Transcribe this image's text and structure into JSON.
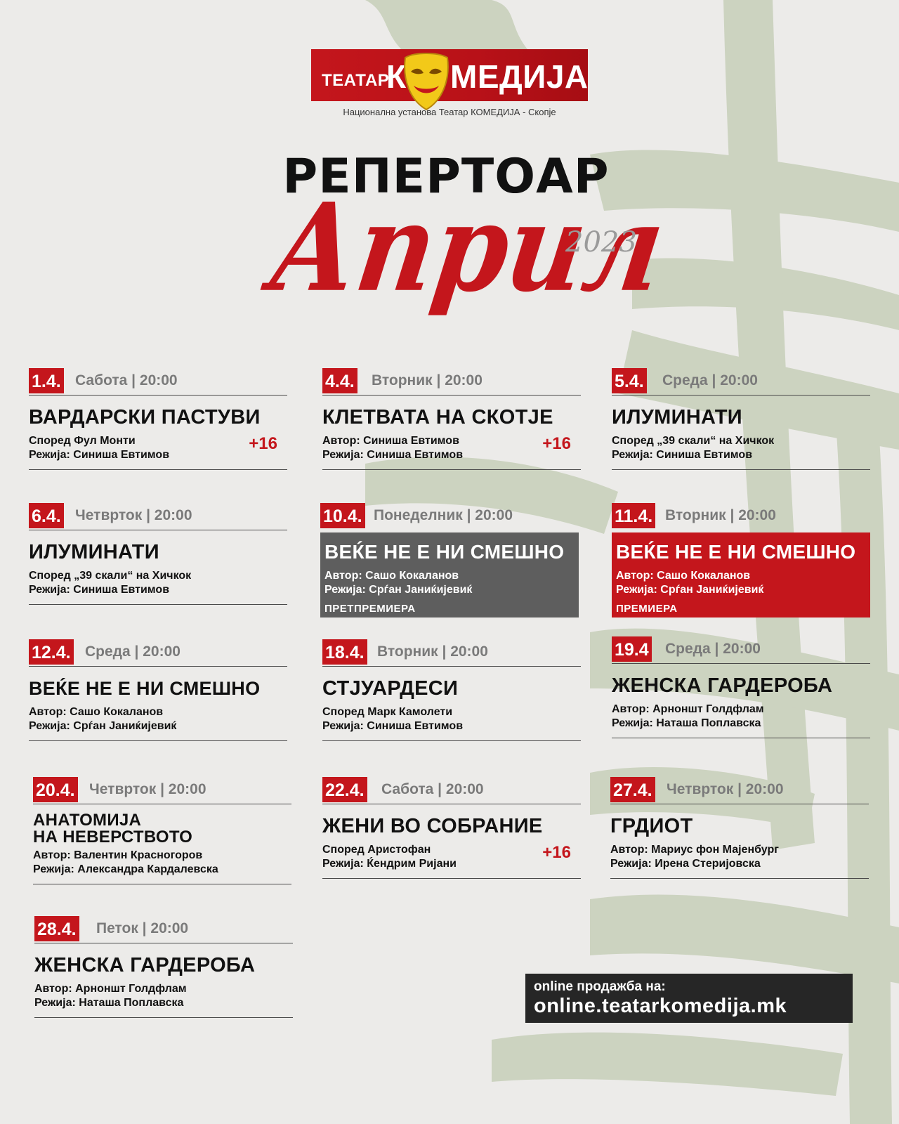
{
  "header": {
    "logo_left": "ТЕАТАР",
    "logo_k": "К",
    "logo_right": "МЕДИЈА",
    "subtitle": "Национална установа Театар КОМЕДИЈА - Скопје",
    "title": "РЕПЕРТОАР",
    "month": "Април",
    "year": "2023"
  },
  "colors": {
    "accent": "#c4161c",
    "highlight_gray": "#5e5e5e",
    "text": "#111111",
    "muted": "#7a7a7a",
    "online_bg": "#262626"
  },
  "events": [
    {
      "date": "1.4.",
      "day_time": "Сабота | 20:00",
      "title": "ВАРДАРСКИ ПАСТУВИ",
      "line1": "Според Фул Монти",
      "line2": "Режија: Синиша Евтимов",
      "age": "+16"
    },
    {
      "date": "4.4.",
      "day_time": "Вторник | 20:00",
      "title": "КЛЕТВАТА НА СКОТЈЕ",
      "line1": "Автор: Синиша Евтимов",
      "line2": "Режија: Синиша Евтимов",
      "age": "+16"
    },
    {
      "date": "5.4.",
      "day_time": "Среда | 20:00",
      "title": "ИЛУМИНАТИ",
      "line1": "Според „39 скали“ на Хичкок",
      "line2": "Режија: Синиша Евтимов"
    },
    {
      "date": "6.4.",
      "day_time": "Четврток | 20:00",
      "title": "ИЛУМИНАТИ",
      "line1": "Според „39 скали“ на Хичкок",
      "line2": "Режија: Синиша Евтимов"
    },
    {
      "date": "10.4.",
      "day_time": "Понеделник | 20:00",
      "title": "ВЕЌЕ НЕ Е НИ СМЕШНО",
      "line1": "Автор: Сашо Кокаланов",
      "line2": "Режија: Срѓан Јаниќијевиќ",
      "tag": "ПРЕТПРЕМИЕРА"
    },
    {
      "date": "11.4.",
      "day_time": "Вторник | 20:00",
      "title": "ВЕЌЕ НЕ Е НИ СМЕШНО",
      "line1": "Автор: Сашо Кокаланов",
      "line2": "Режија: Срѓан Јаниќијевиќ",
      "tag": "ПРЕМИЕРА"
    },
    {
      "date": "12.4.",
      "day_time": "Среда | 20:00",
      "title": "ВЕЌЕ НЕ Е НИ СМЕШНО",
      "line1": "Автор: Сашо Кокаланов",
      "line2": "Режија: Срѓан Јаниќијевиќ"
    },
    {
      "date": "18.4.",
      "day_time": "Вторник | 20:00",
      "title": "СТЈУАРДЕСИ",
      "line1": "Според Марк Камолети",
      "line2": "Режија: Синиша Евтимов"
    },
    {
      "date": "19.4",
      "day_time": "Среда | 20:00",
      "title": "ЖЕНСКА ГАРДЕРОБА",
      "line1": "Автор: Арноншт Голдфлам",
      "line2": "Режија: Наташа Поплавска"
    },
    {
      "date": "20.4.",
      "day_time": "Четврток | 20:00",
      "title": "АНАТОМИЈА",
      "title2": "НА НЕВЕРСТВОТО",
      "line1": "Автор: Валентин Красногоров",
      "line2": "Режија: Александра Кардалевска"
    },
    {
      "date": "22.4.",
      "day_time": "Сабота | 20:00",
      "title": "ЖЕНИ ВО СОБРАНИЕ",
      "line1": "Според Аристофан",
      "line2": "Режија: Ќендрим Ријани",
      "age": "+16"
    },
    {
      "date": "27.4.",
      "day_time": "Четврток | 20:00",
      "title": "ГРДИОТ",
      "line1": "Автор: Мариус фон Мајенбург",
      "line2": "Режија: Ирена Стеријовска"
    },
    {
      "date": "28.4.",
      "day_time": "Петок | 20:00",
      "title": "ЖЕНСКА ГАРДЕРОБА",
      "line1": "Автор: Арноншт Голдфлам",
      "line2": "Режија: Наташа Поплавска"
    }
  ],
  "online": {
    "label": "online продажба на:",
    "url": "online.teatarkomedija.mk"
  }
}
